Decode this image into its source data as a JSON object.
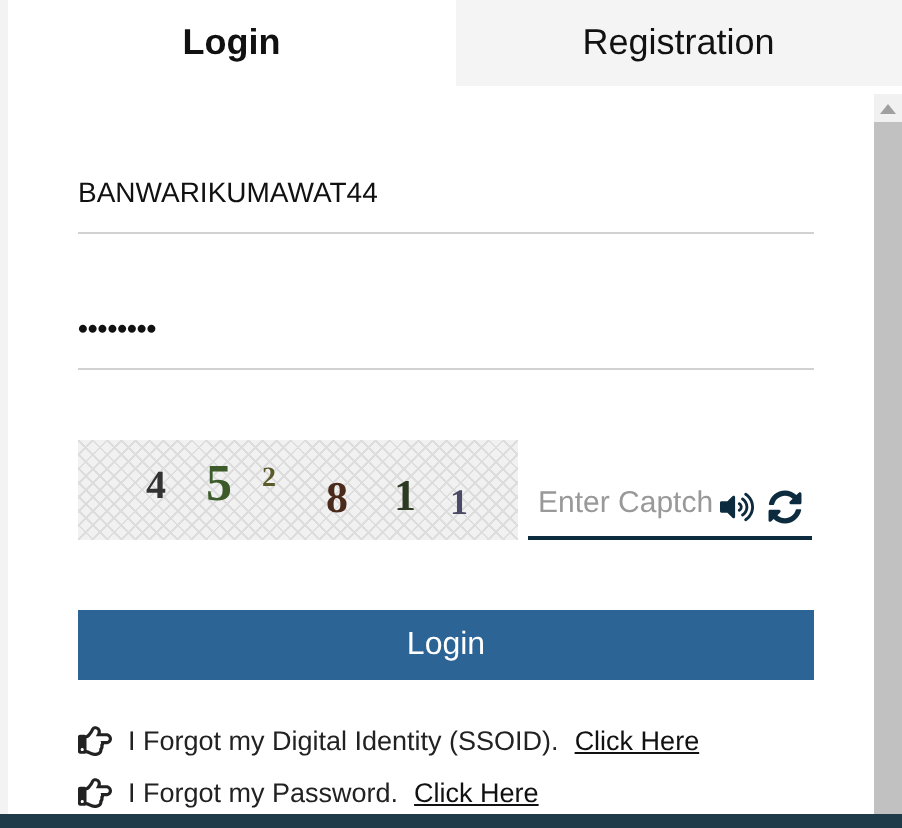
{
  "tabs": [
    {
      "label": "Login",
      "selected": true
    },
    {
      "label": "Registration",
      "selected": false
    }
  ],
  "username": {
    "value": "BANWARIKUMAWAT44"
  },
  "password": {
    "value": "••••••••"
  },
  "captcha": {
    "chars": [
      "4",
      "5",
      "2",
      "8",
      "1",
      "1"
    ],
    "placeholder": "Enter Captch"
  },
  "login_button": "Login",
  "help_links": [
    {
      "text": "I Forgot my Digital Identity (SSOID).",
      "link": "Click Here"
    },
    {
      "text": "I Forgot my Password.",
      "link": "Click Here"
    }
  ]
}
